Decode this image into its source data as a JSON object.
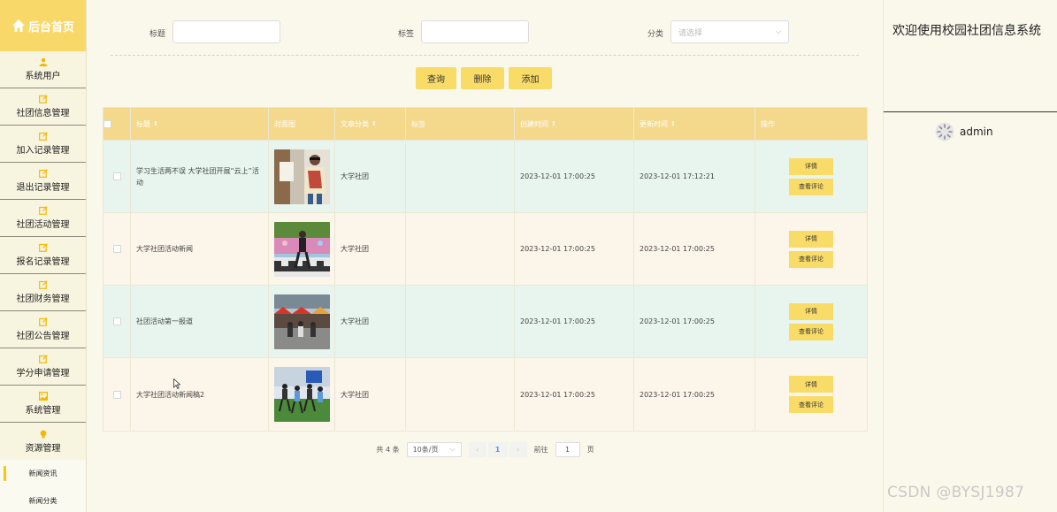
{
  "sidebar": {
    "brand": "后台首页",
    "items": [
      {
        "label": "系统用户",
        "icon": "user-icon"
      },
      {
        "label": "社团信息管理",
        "icon": "edit-icon"
      },
      {
        "label": "加入记录管理",
        "icon": "edit-icon"
      },
      {
        "label": "退出记录管理",
        "icon": "edit-icon"
      },
      {
        "label": "社团活动管理",
        "icon": "edit-icon"
      },
      {
        "label": "报名记录管理",
        "icon": "edit-icon"
      },
      {
        "label": "社团财务管理",
        "icon": "edit-icon"
      },
      {
        "label": "社团公告管理",
        "icon": "edit-icon"
      },
      {
        "label": "学分申请管理",
        "icon": "edit-icon"
      },
      {
        "label": "系统管理",
        "icon": "picture-icon"
      },
      {
        "label": "资源管理",
        "icon": "bulb-icon"
      }
    ],
    "submenu": [
      {
        "label": "新闻资讯"
      },
      {
        "label": "新闻分类"
      }
    ],
    "accent": "#f9d86a"
  },
  "search": {
    "title_label": "标题",
    "title_value": "",
    "tag_label": "标签",
    "tag_value": "",
    "category_label": "分类",
    "category_placeholder": "请选择"
  },
  "actions": {
    "query": "查询",
    "delete": "删除",
    "add": "添加"
  },
  "table": {
    "headers": [
      "标题",
      "封面图",
      "文章分类",
      "标签",
      "创建时间",
      "更新时间",
      "操作"
    ],
    "rows": [
      {
        "title": "学习生活两不误 大学社团开展“云上”活动",
        "category": "大学社团",
        "tag": "",
        "created": "2023-12-01 17:00:25",
        "updated": "2023-12-01 17:12:21",
        "detail": "详情",
        "comments": "查看评论"
      },
      {
        "title": "大学社团活动新闻",
        "category": "大学社团",
        "tag": "",
        "created": "2023-12-01 17:00:25",
        "updated": "2023-12-01 17:00:25",
        "detail": "详情",
        "comments": "查看评论"
      },
      {
        "title": "社团活动第一报道",
        "category": "大学社团",
        "tag": "",
        "created": "2023-12-01 17:00:25",
        "updated": "2023-12-01 17:00:25",
        "detail": "详情",
        "comments": "查看评论"
      },
      {
        "title": "大学社团活动新闻稿2",
        "category": "大学社团",
        "tag": "",
        "created": "2023-12-01 17:00:25",
        "updated": "2023-12-01 17:00:25",
        "detail": "详情",
        "comments": "查看评论"
      }
    ]
  },
  "pagination": {
    "total": "共 4 条",
    "page_size": "10条/页",
    "current": "1",
    "goto_label": "前往",
    "goto_value": "1",
    "page_suffix": "页"
  },
  "right_panel": {
    "welcome": "欢迎使用校园社团信息系统",
    "username": "admin"
  },
  "watermark": "CSDN @BYSJ1987"
}
